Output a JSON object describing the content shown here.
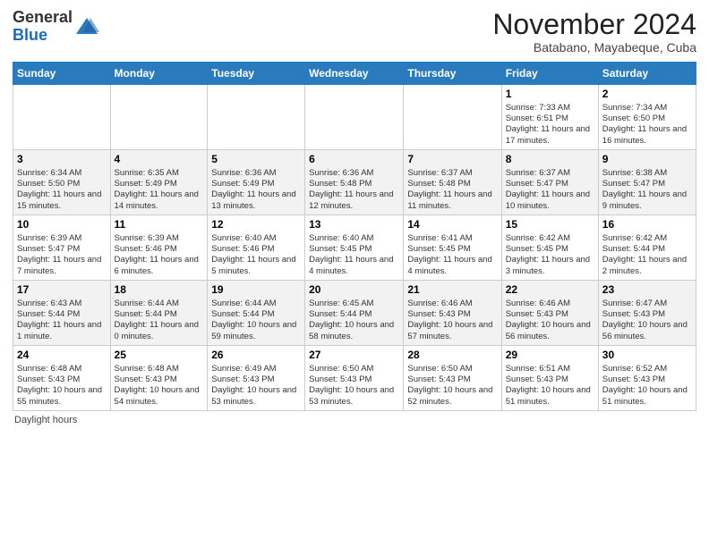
{
  "header": {
    "logo": {
      "line1": "General",
      "line2": "Blue"
    },
    "title": "November 2024",
    "location": "Batabano, Mayabeque, Cuba"
  },
  "weekdays": [
    "Sunday",
    "Monday",
    "Tuesday",
    "Wednesday",
    "Thursday",
    "Friday",
    "Saturday"
  ],
  "footer": "Daylight hours",
  "weeks": [
    [
      {
        "day": "",
        "info": ""
      },
      {
        "day": "",
        "info": ""
      },
      {
        "day": "",
        "info": ""
      },
      {
        "day": "",
        "info": ""
      },
      {
        "day": "",
        "info": ""
      },
      {
        "day": "1",
        "info": "Sunrise: 7:33 AM\nSunset: 6:51 PM\nDaylight: 11 hours and 17 minutes."
      },
      {
        "day": "2",
        "info": "Sunrise: 7:34 AM\nSunset: 6:50 PM\nDaylight: 11 hours and 16 minutes."
      }
    ],
    [
      {
        "day": "3",
        "info": "Sunrise: 6:34 AM\nSunset: 5:50 PM\nDaylight: 11 hours and 15 minutes."
      },
      {
        "day": "4",
        "info": "Sunrise: 6:35 AM\nSunset: 5:49 PM\nDaylight: 11 hours and 14 minutes."
      },
      {
        "day": "5",
        "info": "Sunrise: 6:36 AM\nSunset: 5:49 PM\nDaylight: 11 hours and 13 minutes."
      },
      {
        "day": "6",
        "info": "Sunrise: 6:36 AM\nSunset: 5:48 PM\nDaylight: 11 hours and 12 minutes."
      },
      {
        "day": "7",
        "info": "Sunrise: 6:37 AM\nSunset: 5:48 PM\nDaylight: 11 hours and 11 minutes."
      },
      {
        "day": "8",
        "info": "Sunrise: 6:37 AM\nSunset: 5:47 PM\nDaylight: 11 hours and 10 minutes."
      },
      {
        "day": "9",
        "info": "Sunrise: 6:38 AM\nSunset: 5:47 PM\nDaylight: 11 hours and 9 minutes."
      }
    ],
    [
      {
        "day": "10",
        "info": "Sunrise: 6:39 AM\nSunset: 5:47 PM\nDaylight: 11 hours and 7 minutes."
      },
      {
        "day": "11",
        "info": "Sunrise: 6:39 AM\nSunset: 5:46 PM\nDaylight: 11 hours and 6 minutes."
      },
      {
        "day": "12",
        "info": "Sunrise: 6:40 AM\nSunset: 5:46 PM\nDaylight: 11 hours and 5 minutes."
      },
      {
        "day": "13",
        "info": "Sunrise: 6:40 AM\nSunset: 5:45 PM\nDaylight: 11 hours and 4 minutes."
      },
      {
        "day": "14",
        "info": "Sunrise: 6:41 AM\nSunset: 5:45 PM\nDaylight: 11 hours and 4 minutes."
      },
      {
        "day": "15",
        "info": "Sunrise: 6:42 AM\nSunset: 5:45 PM\nDaylight: 11 hours and 3 minutes."
      },
      {
        "day": "16",
        "info": "Sunrise: 6:42 AM\nSunset: 5:44 PM\nDaylight: 11 hours and 2 minutes."
      }
    ],
    [
      {
        "day": "17",
        "info": "Sunrise: 6:43 AM\nSunset: 5:44 PM\nDaylight: 11 hours and 1 minute."
      },
      {
        "day": "18",
        "info": "Sunrise: 6:44 AM\nSunset: 5:44 PM\nDaylight: 11 hours and 0 minutes."
      },
      {
        "day": "19",
        "info": "Sunrise: 6:44 AM\nSunset: 5:44 PM\nDaylight: 10 hours and 59 minutes."
      },
      {
        "day": "20",
        "info": "Sunrise: 6:45 AM\nSunset: 5:44 PM\nDaylight: 10 hours and 58 minutes."
      },
      {
        "day": "21",
        "info": "Sunrise: 6:46 AM\nSunset: 5:43 PM\nDaylight: 10 hours and 57 minutes."
      },
      {
        "day": "22",
        "info": "Sunrise: 6:46 AM\nSunset: 5:43 PM\nDaylight: 10 hours and 56 minutes."
      },
      {
        "day": "23",
        "info": "Sunrise: 6:47 AM\nSunset: 5:43 PM\nDaylight: 10 hours and 56 minutes."
      }
    ],
    [
      {
        "day": "24",
        "info": "Sunrise: 6:48 AM\nSunset: 5:43 PM\nDaylight: 10 hours and 55 minutes."
      },
      {
        "day": "25",
        "info": "Sunrise: 6:48 AM\nSunset: 5:43 PM\nDaylight: 10 hours and 54 minutes."
      },
      {
        "day": "26",
        "info": "Sunrise: 6:49 AM\nSunset: 5:43 PM\nDaylight: 10 hours and 53 minutes."
      },
      {
        "day": "27",
        "info": "Sunrise: 6:50 AM\nSunset: 5:43 PM\nDaylight: 10 hours and 53 minutes."
      },
      {
        "day": "28",
        "info": "Sunrise: 6:50 AM\nSunset: 5:43 PM\nDaylight: 10 hours and 52 minutes."
      },
      {
        "day": "29",
        "info": "Sunrise: 6:51 AM\nSunset: 5:43 PM\nDaylight: 10 hours and 51 minutes."
      },
      {
        "day": "30",
        "info": "Sunrise: 6:52 AM\nSunset: 5:43 PM\nDaylight: 10 hours and 51 minutes."
      }
    ]
  ]
}
